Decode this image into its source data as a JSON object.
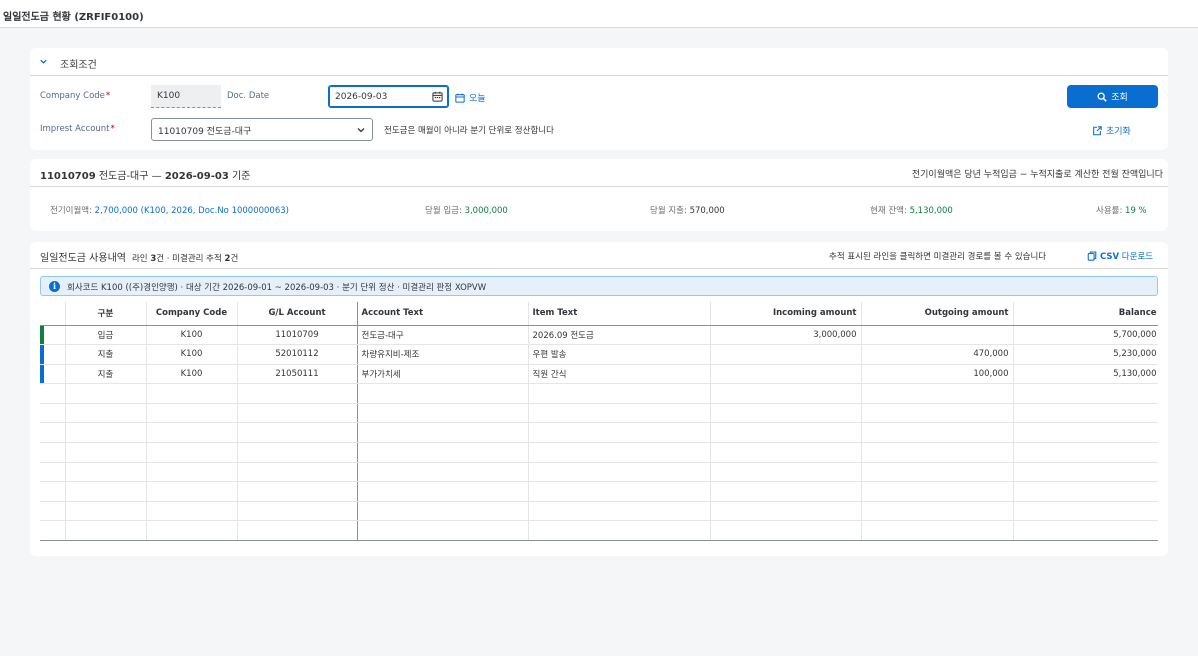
{
  "shell": {
    "title": "일일전도금 현황 (ZRFIF0100)"
  },
  "filter": {
    "title": "조회조건",
    "company_code_label": "Company Code",
    "company_code_value": "K100",
    "doc_date_label": "Doc. Date",
    "doc_date_value": "2026-09-03",
    "today_label": "오늘",
    "imprest_label": "Imprest Account",
    "imprest_value": "11010709 전도금-대구",
    "hint": "전도금은 매월이 아니라 분기 단위로 정산합니다",
    "search_label": "조회",
    "reset_label": "초기화",
    "required_mark": "*"
  },
  "summary": {
    "title_bold": "11010709",
    "title_mid": " 전도금-대구 — ",
    "title_date": "2026-09-03",
    "title_suffix": " 기준",
    "note": "전기이월액은 당년 누적입금 − 누적지출로 계산한 전월 잔액입니다",
    "carryover_label": "전기이월액: ",
    "carryover_value": "2,700,000 (K100, 2026, Doc.No 1000000063)",
    "incoming_label": "당월 입금: ",
    "incoming_value": "3,000,000",
    "outgoing_label": "당월 지출: ",
    "outgoing_value": "570,000",
    "balance_label": "현재 잔액: ",
    "balance_value": "5,130,000",
    "usage_label": "사용률: ",
    "usage_value": "19 %"
  },
  "detail": {
    "title": "일일전도금 사용내역",
    "sub_pre": "라인 ",
    "sub_lines": "3",
    "sub_mid": "건 · 미결관리 추적 ",
    "sub_tracked": "2",
    "sub_post": "건",
    "note": "추적 표시된 라인을 클릭하면 미결관리 경로를 볼 수 있습니다",
    "csv_bold": "CSV",
    "csv_rest": " 다운로드",
    "info": "회사코드 K100 ((주)경인양행) · 대상 기간 2026-09-01 ~ 2026-09-03 · 분기 단위 정산 · 미결관리 판정 XOPVW",
    "columns": [
      "구분",
      "Company Code",
      "G/L Account",
      "Account Text",
      "Item Text",
      "Incoming amount",
      "Outgoing amount",
      "Balance"
    ],
    "rows": [
      {
        "mark": "#107e3e",
        "type": "입금",
        "company": "K100",
        "gl": "11010709",
        "account_text": "전도금-대구",
        "item_text": "2026.09 전도금",
        "incoming": "3,000,000",
        "outgoing": "",
        "balance": "5,700,000"
      },
      {
        "mark": "#0a6ed1",
        "type": "지출",
        "company": "K100",
        "gl": "52010112",
        "account_text": "차량유지비-제조",
        "item_text": "우편 발송",
        "incoming": "",
        "outgoing": "470,000",
        "balance": "5,230,000"
      },
      {
        "mark": "#0a6ed1",
        "type": "지출",
        "company": "K100",
        "gl": "21050111",
        "account_text": "부가가치세",
        "item_text": "직원 간식",
        "incoming": "",
        "outgoing": "100,000",
        "balance": "5,130,000"
      }
    ],
    "empty_rows": 8
  },
  "colors": {
    "accent": "#0a6ed1",
    "positive": "#107e3e",
    "required": "#bb0000"
  }
}
